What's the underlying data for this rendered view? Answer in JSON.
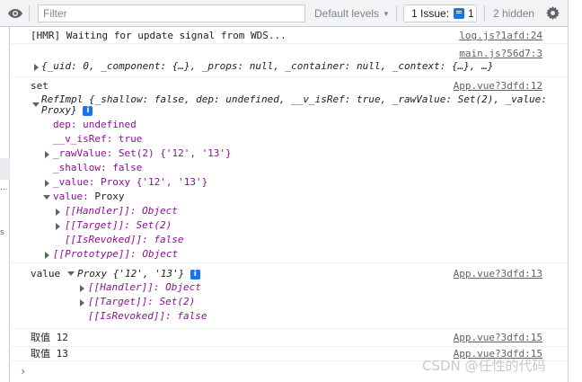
{
  "toolbar": {
    "filter_placeholder": "Filter",
    "levels_label": "Default levels",
    "issues_label": "1 Issue:",
    "issues_count": "1",
    "hidden_label": "2 hidden"
  },
  "left_panel": {
    "dots": "...",
    "letter": "s"
  },
  "messages": {
    "hmr": {
      "text": "[HMR] Waiting for update signal from WDS...",
      "source": "log.js?1afd:24"
    },
    "app": {
      "source": "main.js?56d7:3",
      "summary": "{_uid: 0, _component: {…}, _props: null, _container: null, _context: {…}, …}"
    },
    "set": {
      "label": "set",
      "source": "App.vue?3dfd:12",
      "header_line1": "RefImpl {_shallow: false, dep: undefined, __v_isRef: true, _rawValue: Set(2), _value:",
      "header_line2": "Proxy}",
      "dep": "dep: undefined",
      "v_is_ref": "__v_isRef: true",
      "raw_value": "_rawValue: Set(2) {'12', '13'}",
      "shallow": "_shallow: false",
      "value_preview": "_value: Proxy {'12', '13'}",
      "value_key": "value:",
      "value_type": "Proxy",
      "handler": "[[Handler]]: Object",
      "target": "[[Target]]: Set(2)",
      "is_revoked": "[[IsRevoked]]: false",
      "prototype": "[[Prototype]]: Object"
    },
    "value": {
      "label": "value",
      "preview": "Proxy {'12', '13'}",
      "source": "App.vue?3dfd:13",
      "handler": "[[Handler]]: Object",
      "target": "[[Target]]: Set(2)",
      "is_revoked": "[[IsRevoked]]: false"
    },
    "take12": {
      "text": "取值 12",
      "source": "App.vue?3dfd:15"
    },
    "take13": {
      "text": "取值 13",
      "source": "App.vue?3dfd:15"
    }
  },
  "prompt": "›",
  "watermark": "CSDN @任性的代码"
}
